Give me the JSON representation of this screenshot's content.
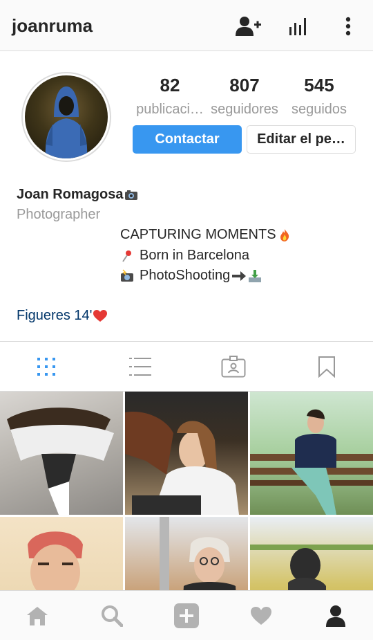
{
  "header": {
    "username": "joanruma",
    "icons": [
      "add-person-icon",
      "stats-bars-icon",
      "more-vertical-icon"
    ]
  },
  "profile": {
    "stats": [
      {
        "value": "82",
        "label": "publicaci…"
      },
      {
        "value": "807",
        "label": "seguidores"
      },
      {
        "value": "545",
        "label": "seguidos"
      }
    ],
    "contact_label": "Contactar",
    "edit_label": "Editar el pe…"
  },
  "bio": {
    "name": "Joan Romagosa",
    "category": "Photographer",
    "lines": [
      "CAPTURING MOMENTS",
      "Born in Barcelona",
      "PhotoShooting"
    ],
    "location": "Figueres 14'"
  },
  "tabs": [
    "grid-icon",
    "list-icon",
    "tagged-icon",
    "saved-icon"
  ],
  "bottom_nav": [
    "home-icon",
    "search-icon",
    "add-icon",
    "heart-icon",
    "profile-icon"
  ],
  "colors": {
    "accent": "#3897f0",
    "muted": "#999999",
    "link": "#003569",
    "border": "#dbdbdb"
  }
}
